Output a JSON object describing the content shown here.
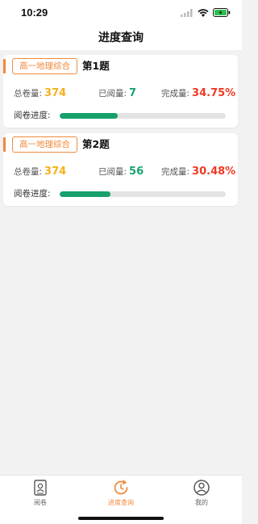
{
  "status": {
    "time": "10:29"
  },
  "nav": {
    "title": "进度查询"
  },
  "cards": [
    {
      "subject": "高一地理综合",
      "question": "第1题",
      "total_label": "总卷量:",
      "total_value": "374",
      "read_label": "已阅量:",
      "read_value": "7",
      "done_label": "完成量:",
      "done_value": "34.75%",
      "progress_label": "阅卷进度:",
      "progress": 0.3475
    },
    {
      "subject": "高一地理综合",
      "question": "第2题",
      "total_label": "总卷量:",
      "total_value": "374",
      "read_label": "已阅量:",
      "read_value": "56",
      "done_label": "完成量:",
      "done_value": "30.48%",
      "progress_label": "阅卷进度:",
      "progress": 0.3048
    }
  ],
  "tabs": [
    {
      "label": "阅卷",
      "icon": "grading-icon",
      "active": false
    },
    {
      "label": "进度查询",
      "icon": "progress-clock-icon",
      "active": true
    },
    {
      "label": "我的",
      "icon": "profile-icon",
      "active": false
    }
  ],
  "colors": {
    "accent": "#f08a3c",
    "progress": "#16a06b",
    "total": "#f5b21b",
    "read": "#1aa36e",
    "done": "#ee3a22"
  }
}
